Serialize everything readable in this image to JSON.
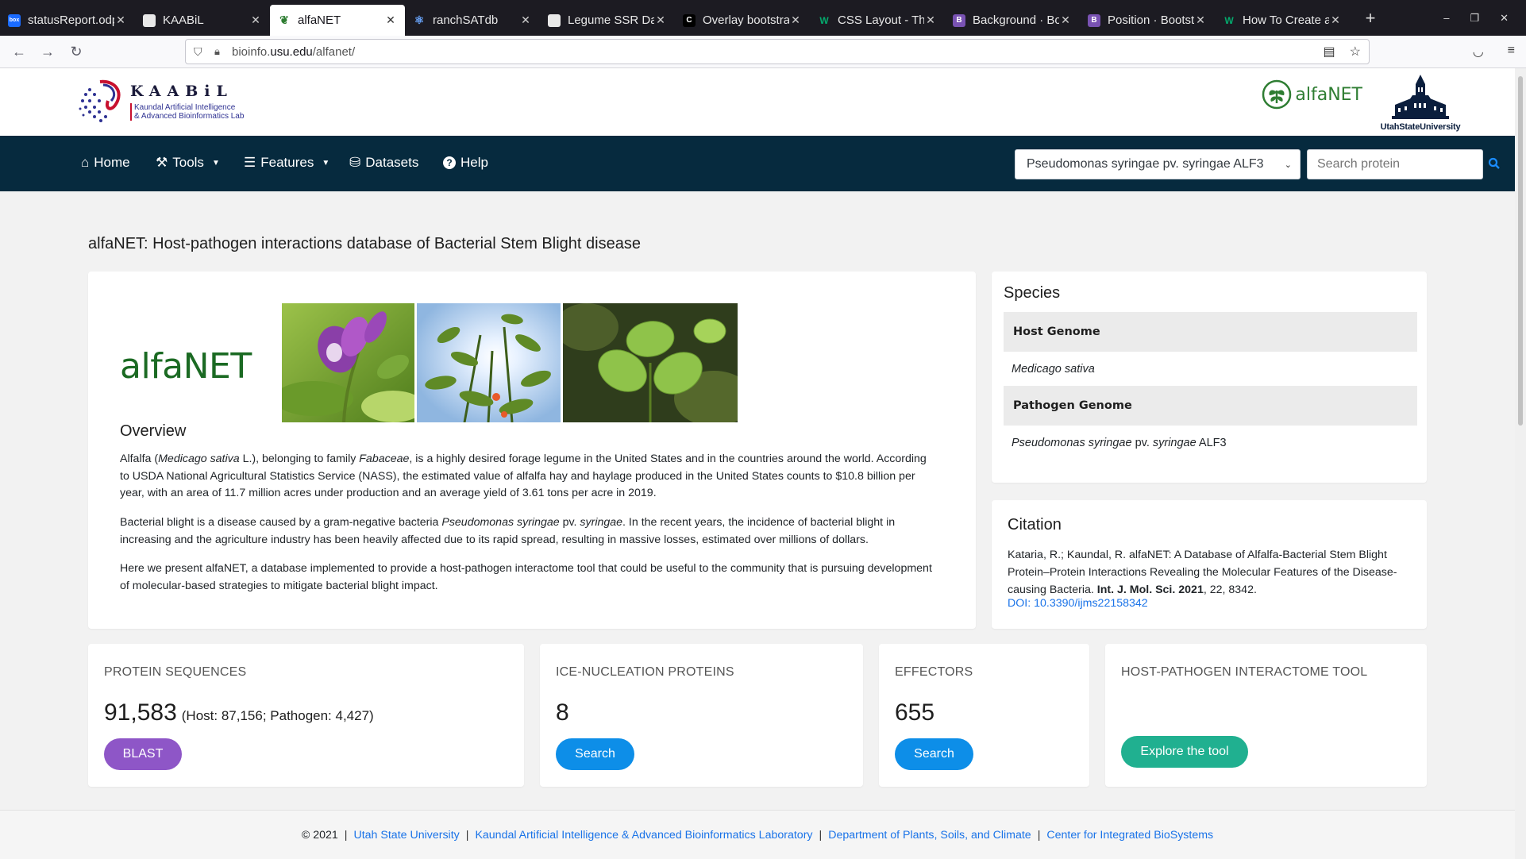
{
  "browser": {
    "tabs": [
      {
        "label": "statusReport.odp",
        "favicon": "box",
        "color": "#1a6bff"
      },
      {
        "label": "KAABiL",
        "favicon": "doc",
        "color": "#ffffff"
      },
      {
        "label": "alfaNET",
        "favicon": "leaf",
        "color": "#2e7d32"
      },
      {
        "label": "ranchSATdb",
        "favicon": "atom",
        "color": "#6aa7ff"
      },
      {
        "label": "Legume SSR Data",
        "favicon": "doc",
        "color": "#ffffff"
      },
      {
        "label": "Overlay bootstrap",
        "favicon": "C",
        "color": "#000000"
      },
      {
        "label": "CSS Layout - The",
        "favicon": "W",
        "color": "#04aa6d"
      },
      {
        "label": "Background · Boo",
        "favicon": "B",
        "color": "#7952b3"
      },
      {
        "label": "Position · Bootstr",
        "favicon": "B",
        "color": "#7952b3"
      },
      {
        "label": "How To Create an",
        "favicon": "W",
        "color": "#04aa6d"
      }
    ],
    "url_domain": "bioinfo.",
    "url_host": "usu.edu",
    "url_path": "/alfanet/",
    "favicon_box_text": "box"
  },
  "header": {
    "kaabil_name": "KAABiL",
    "kaabil_sub_line1": "Kaundal Artificial Intelligence",
    "kaabil_sub_line2": "& Advanced Bioinformatics Lab",
    "alfanet_logo_text": "alfaNET",
    "usu_text": "UtahStateUniversity"
  },
  "nav": {
    "home": "Home",
    "tools": "Tools",
    "features": "Features",
    "datasets": "Datasets",
    "help": "Help",
    "species_selected": "Pseudomonas syringae pv. syringae ALF3",
    "search_placeholder": "Search protein"
  },
  "page_title": "alfaNET: Host-pathogen interactions database of Bacterial Stem Blight disease",
  "overview": {
    "logo_text": "alfaNET",
    "heading": "Overview",
    "p1_a": "Alfalfa (",
    "p1_italic1": "Medicago sativa",
    "p1_b": " L.), belonging to family ",
    "p1_italic2": "Fabaceae",
    "p1_c": ", is a highly desired forage legume in the United States and in the countries around the world. According to USDA National Agricultural Statistics Service (NASS), the estimated value of alfalfa hay and haylage produced in the United States counts to $10.8 billion per year, with an area of 11.7 million acres under production and an average yield of 3.61 tons per acre in 2019.",
    "p2_a": "Bacterial blight is a disease caused by a gram-negative bacteria ",
    "p2_italic1": "Pseudomonas syringae",
    "p2_b": " pv. ",
    "p2_italic2": "syringae",
    "p2_c": ". In the recent years, the incidence of bacterial blight in increasing and the agriculture industry has been heavily affected due to its rapid spread, resulting in massive losses, estimated over millions of dollars.",
    "p3": "Here we present alfaNET, a database implemented to provide a host-pathogen interactome tool that could be useful to the community that is pursuing development of molecular-based strategies to mitigate bacterial blight impact."
  },
  "species": {
    "heading": "Species",
    "host_label": "Host Genome",
    "host_value": "Medicago sativa",
    "pathogen_label": "Pathogen Genome",
    "pathogen_italic1": "Pseudomonas syringae",
    "pathogen_mid": " pv. ",
    "pathogen_italic2": "syringae",
    "pathogen_suffix": " ALF3"
  },
  "citation": {
    "heading": "Citation",
    "text_a": "Kataria, R.; Kaundal, R. alfaNET: A Database of Alfalfa-Bacterial Stem Blight Protein–Protein Interactions Revealing the Molecular Features of the Disease-causing Bacteria. ",
    "journal": "Int. J. Mol. Sci.",
    "year": "2021",
    "text_b": ", 22, 8342.",
    "doi": "DOI: 10.3390/ijms22158342"
  },
  "stats": {
    "proteins_label": "PROTEIN SEQUENCES",
    "proteins_value": "91,583",
    "proteins_sub": "(Host: 87,156; Pathogen: 4,427)",
    "proteins_button": "BLAST",
    "ice_label": "ICE-NUCLEATION PROTEINS",
    "ice_value": "8",
    "ice_button": "Search",
    "effectors_label": "EFFECTORS",
    "effectors_value": "655",
    "effectors_button": "Search",
    "tool_label": "HOST-PATHOGEN INTERACTOME TOOL",
    "tool_button": "Explore the tool"
  },
  "footer": {
    "copyright": "© 2021",
    "link1": "Utah State University",
    "link2": "Kaundal Artificial Intelligence & Advanced Bioinformatics Laboratory",
    "link3": "Department of Plants, Soils, and Climate",
    "link4": "Center for Integrated BioSystems",
    "separator": "|"
  },
  "colors": {
    "nav_bg": "#062a3e",
    "blast_purple": "#8e56c7",
    "search_blue": "#0d8ee8",
    "explore_teal": "#20b090",
    "link_blue": "#1a73e8",
    "alfanet_green": "#1b6a23"
  }
}
